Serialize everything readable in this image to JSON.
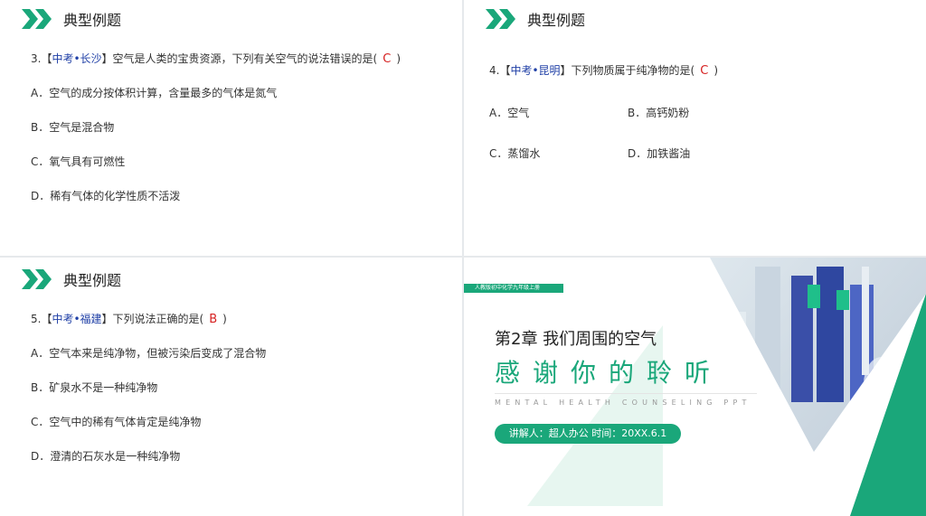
{
  "colors": {
    "accent": "#1aa77a",
    "answer": "#d62020",
    "tag": "#1f3fa6"
  },
  "slide1": {
    "title": "典型例题",
    "question": {
      "prefix": "3.【",
      "tag": "中考•长沙",
      "text": "】空气是人类的宝贵资源，下列有关空气的说法错误的是(",
      "answer": "C",
      "suffix": ")"
    },
    "options": [
      "A．空气的成分按体积计算，含量最多的气体是氮气",
      "B．空气是混合物",
      "C．氧气具有可燃性",
      "D．稀有气体的化学性质不活泼"
    ]
  },
  "slide2": {
    "title": "典型例题",
    "question": {
      "prefix": "4.【",
      "tag": "中考•昆明",
      "text": "】下列物质属于纯净物的是(",
      "answer": "C",
      "suffix": ")"
    },
    "options": [
      "A．空气",
      "B．高钙奶粉",
      "C．蒸馏水",
      "D．加铁酱油"
    ]
  },
  "slide3": {
    "title": "典型例题",
    "question": {
      "prefix": "5.【",
      "tag": "中考•福建",
      "text": "】下列说法正确的是(",
      "answer": "B",
      "suffix": ")"
    },
    "options": [
      "A．空气本来是纯净物，但被污染后变成了混合物",
      "B．矿泉水不是一种纯净物",
      "C．空气中的稀有气体肯定是纯净物",
      "D．澄清的石灰水是一种纯净物"
    ]
  },
  "slide4": {
    "badge": "人教版初中化学九年级上册",
    "chapter": "第2章 我们周围的空气",
    "thanks": "感谢你的聆听",
    "subtitle": "MENTAL HEALTH COUNSELING PPT",
    "presenter": "讲解人：超人办公 时间：20XX.6.1"
  }
}
